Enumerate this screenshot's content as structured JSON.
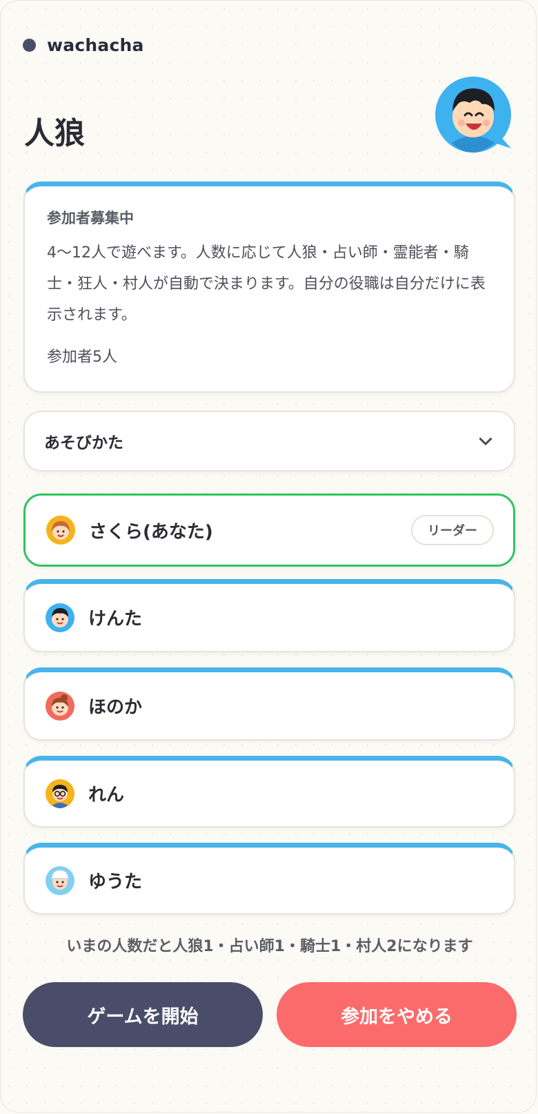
{
  "app": {
    "name": "wachacha"
  },
  "page": {
    "title": "人狼"
  },
  "info": {
    "status": "参加者募集中",
    "description": "4〜12人で遊べます。人数に応じて人狼・占い師・霊能者・騎士・狂人・村人が自動で決まります。自分の役職は自分だけに表示されます。",
    "participants": "参加者5人"
  },
  "howto": {
    "label": "あそびかた",
    "icon": "chevron-down-icon"
  },
  "players": [
    {
      "name": "さくら(あなた)",
      "badge": "リーダー",
      "avatar": "girl-avatar-orange",
      "is_you": true
    },
    {
      "name": "けんた",
      "avatar": "boy-avatar-blue"
    },
    {
      "name": "ほのか",
      "avatar": "girl-avatar-red"
    },
    {
      "name": "れん",
      "avatar": "glasses-avatar-yellow"
    },
    {
      "name": "ゆうた",
      "avatar": "cap-avatar-lightblue"
    }
  ],
  "role_hint": "いまの人数だと人狼1・占い師1・騎士1・村人2になります",
  "buttons": {
    "start": "ゲームを開始",
    "leave": "参加をやめる"
  },
  "colors": {
    "accent_blue": "#48b4ea",
    "you_border": "#2fc35f",
    "start_btn": "#4a4d69",
    "leave_btn": "#fb6b6c"
  }
}
